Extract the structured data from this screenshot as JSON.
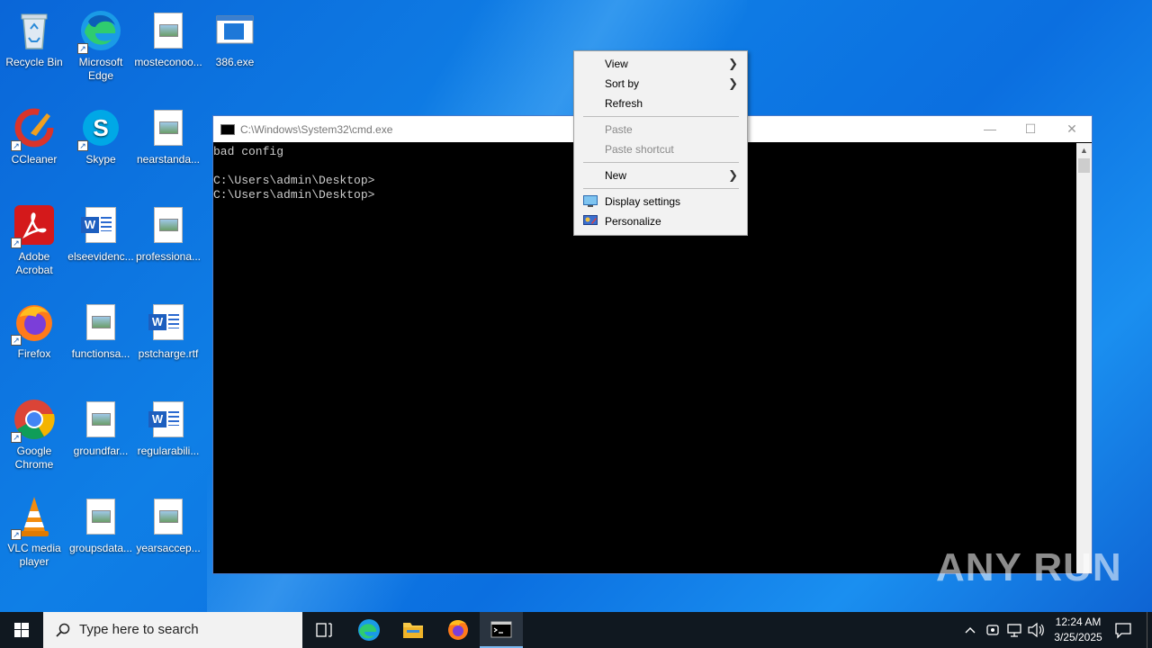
{
  "desktop": {
    "icons": [
      {
        "label": "Recycle Bin"
      },
      {
        "label": "Microsoft Edge"
      },
      {
        "label": "mosteconoo..."
      },
      {
        "label": "386.exe"
      },
      {
        "label": "CCleaner"
      },
      {
        "label": "Skype"
      },
      {
        "label": "nearstanda..."
      },
      {
        "label": "Adobe Acrobat"
      },
      {
        "label": "elseevidenc..."
      },
      {
        "label": "professiona..."
      },
      {
        "label": "Firefox"
      },
      {
        "label": "functionsa..."
      },
      {
        "label": "pstcharge.rtf"
      },
      {
        "label": "Google Chrome"
      },
      {
        "label": "groundfar..."
      },
      {
        "label": "regularabili..."
      },
      {
        "label": "VLC media player"
      },
      {
        "label": "groupsdata..."
      },
      {
        "label": "yearsaccep..."
      }
    ]
  },
  "cmd_window": {
    "title": "C:\\Windows\\System32\\cmd.exe",
    "lines": [
      "bad config",
      "",
      "C:\\Users\\admin\\Desktop>",
      "C:\\Users\\admin\\Desktop>"
    ]
  },
  "context_menu": {
    "view": "View",
    "sort_by": "Sort by",
    "refresh": "Refresh",
    "paste": "Paste",
    "paste_shortcut": "Paste shortcut",
    "new": "New",
    "display_settings": "Display settings",
    "personalize": "Personalize"
  },
  "taskbar": {
    "search_placeholder": "Type here to search",
    "time": "12:24 AM",
    "date": "3/25/2025"
  },
  "watermark": "ANY RUN"
}
